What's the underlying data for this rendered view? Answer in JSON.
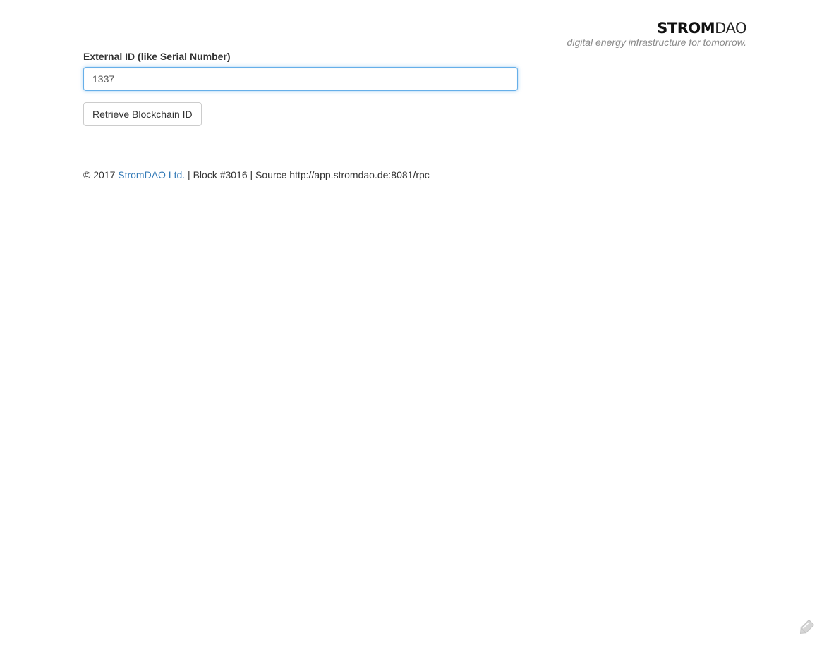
{
  "brand": {
    "logo_bold": "STROM",
    "logo_light": "DAO",
    "tagline": "digital energy infrastructure for tomorrow."
  },
  "form": {
    "label": "External ID (like Serial Number)",
    "input_value": "1337",
    "button_label": "Retrieve Blockchain ID"
  },
  "footer": {
    "copyright": "© 2017 ",
    "company_link": "StromDAO Ltd.",
    "block_info": " | Block #3016 | Source http://app.stromdao.de:8081/rpc"
  },
  "icons": {
    "corner": "pencil-icon"
  },
  "colors": {
    "link": "#337ab7",
    "focus_border": "#66afe9",
    "tagline": "#8a8a8a"
  }
}
